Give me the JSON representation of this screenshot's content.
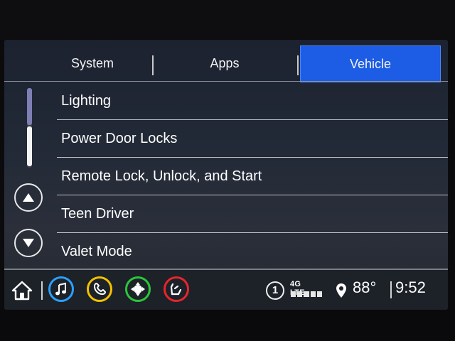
{
  "tabs": [
    {
      "label": "System",
      "active": false
    },
    {
      "label": "Apps",
      "active": false
    },
    {
      "label": "Vehicle",
      "active": true
    }
  ],
  "menu": {
    "items": [
      {
        "label": "Lighting"
      },
      {
        "label": "Power Door Locks"
      },
      {
        "label": "Remote Lock, Unlock, and Start"
      },
      {
        "label": "Teen Driver"
      },
      {
        "label": "Valet Mode"
      }
    ]
  },
  "status": {
    "notification_count": "1",
    "network": "4G LTE",
    "signal_bars": 5,
    "temperature": "88°",
    "time": "9:52"
  },
  "colors": {
    "active_tab": "#1d5de6",
    "music": "#2aa0ff",
    "phone": "#f2c100",
    "navigation": "#2ac63a",
    "seat": "#e8252b"
  },
  "icons": [
    "home-icon",
    "music-icon",
    "phone-icon",
    "navigation-icon",
    "seat-icon",
    "location-pin-icon"
  ]
}
